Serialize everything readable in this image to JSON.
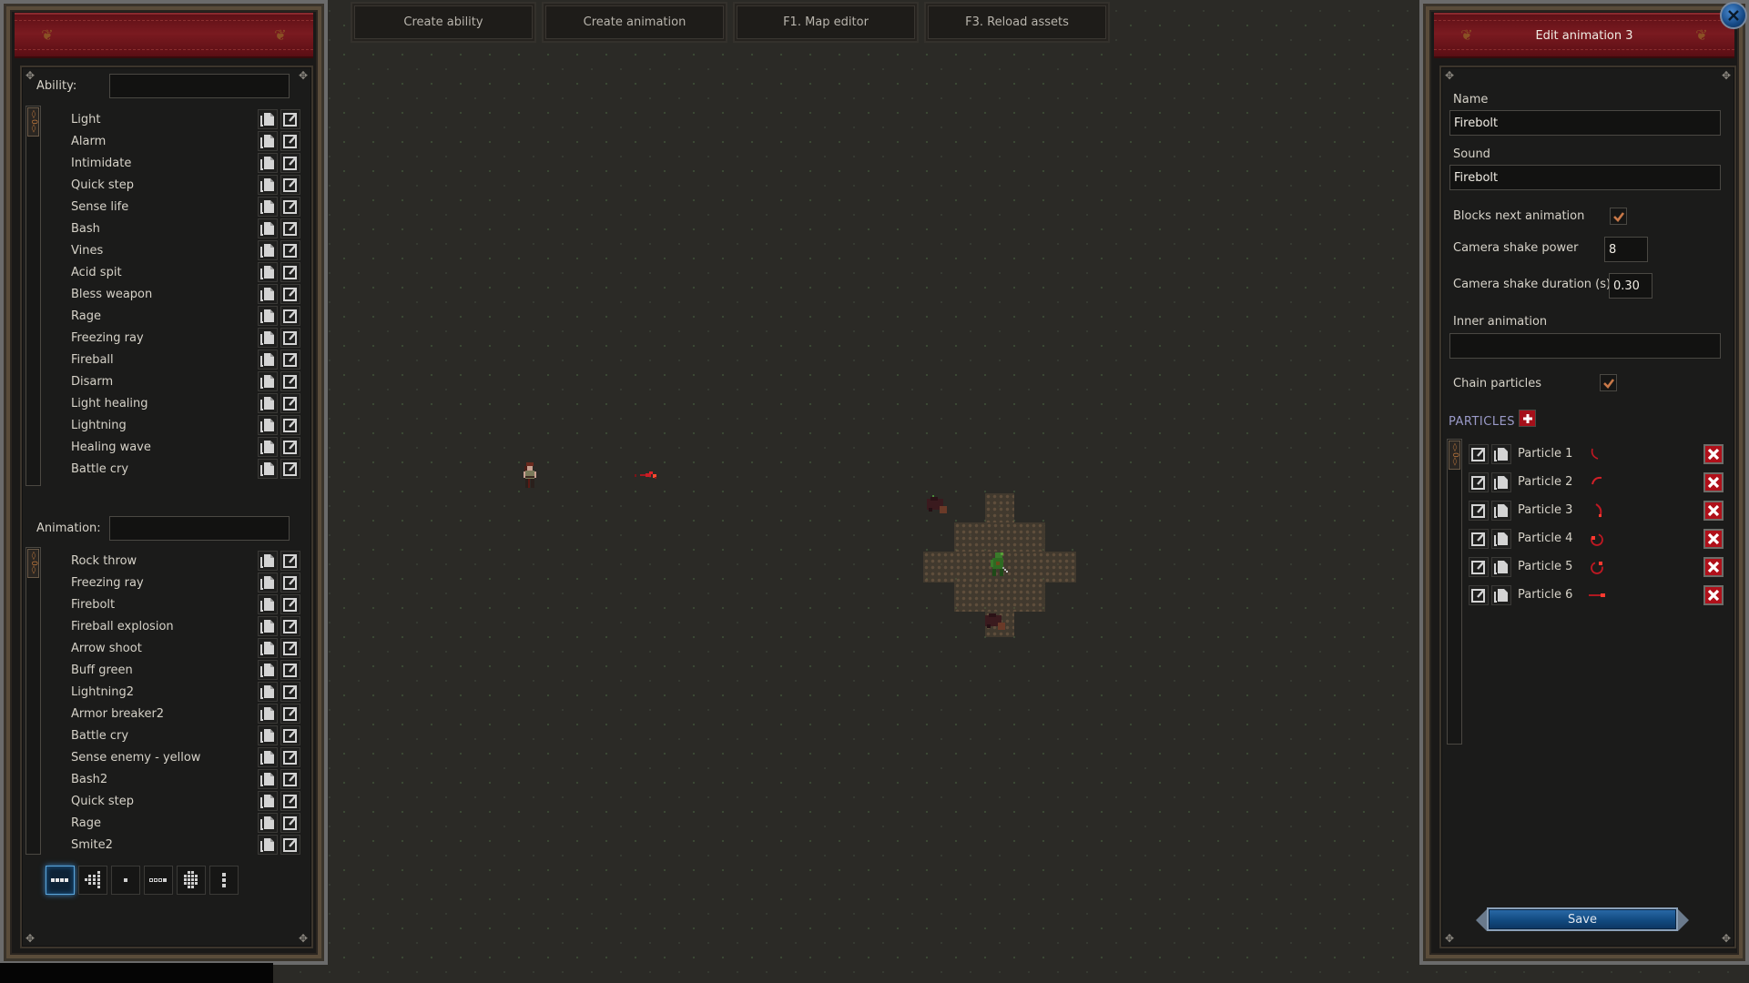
{
  "toolbar": {
    "buttons": [
      {
        "label": "Create ability"
      },
      {
        "label": "Create animation"
      },
      {
        "label": "F1. Map editor"
      },
      {
        "label": "F3. Reload assets"
      }
    ]
  },
  "left_panel": {
    "ability": {
      "label": "Ability:",
      "filter_value": "",
      "items": [
        "Light",
        "Alarm",
        "Intimidate",
        "Quick step",
        "Sense life",
        "Bash",
        "Vines",
        "Acid spit",
        "Bless weapon",
        "Rage",
        "Freezing ray",
        "Fireball",
        "Disarm",
        "Light healing",
        "Lightning",
        "Healing wave",
        "Battle cry"
      ]
    },
    "animation": {
      "label": "Animation:",
      "filter_value": "",
      "items": [
        "Rock throw",
        "Freezing ray",
        "Firebolt",
        "Fireball explosion",
        "Arrow shoot",
        "Buff green",
        "Lightning2",
        "Armor breaker2",
        "Battle cry",
        "Sense enemy - yellow",
        "Bash2",
        "Quick step",
        "Rage",
        "Smite2"
      ]
    },
    "shape_buttons": [
      {
        "name": "line-horizontal",
        "active": true
      },
      {
        "name": "cone",
        "active": false
      },
      {
        "name": "single",
        "active": false
      },
      {
        "name": "line-hollow",
        "active": false
      },
      {
        "name": "cross-large",
        "active": false
      },
      {
        "name": "line-vertical",
        "active": false
      }
    ]
  },
  "edit_panel": {
    "title": "Edit animation 3",
    "name_label": "Name",
    "name_value": "Firebolt",
    "sound_label": "Sound",
    "sound_value": "Firebolt",
    "blocks_next_label": "Blocks next animation",
    "blocks_next_checked": true,
    "shake_power_label": "Camera shake power",
    "shake_power_value": "8",
    "shake_duration_label": "Camera shake duration (s)",
    "shake_duration_value": "0.30",
    "inner_animation_label": "Inner animation",
    "inner_animation_value": "",
    "chain_particles_label": "Chain particles",
    "chain_particles_checked": true,
    "particles_title": "PARTICLES",
    "particles": [
      {
        "name": "Particle 1"
      },
      {
        "name": "Particle 2"
      },
      {
        "name": "Particle 3"
      },
      {
        "name": "Particle 4"
      },
      {
        "name": "Particle 5"
      },
      {
        "name": "Particle 6"
      }
    ],
    "save_label": "Save"
  },
  "colors": {
    "header_red": "#7a1a20",
    "accent_blue": "#124a80",
    "delete_red": "#b0101a",
    "particle_red": "#d8202a",
    "section_title": "#9a9ac8",
    "check_orange": "#c87848"
  }
}
